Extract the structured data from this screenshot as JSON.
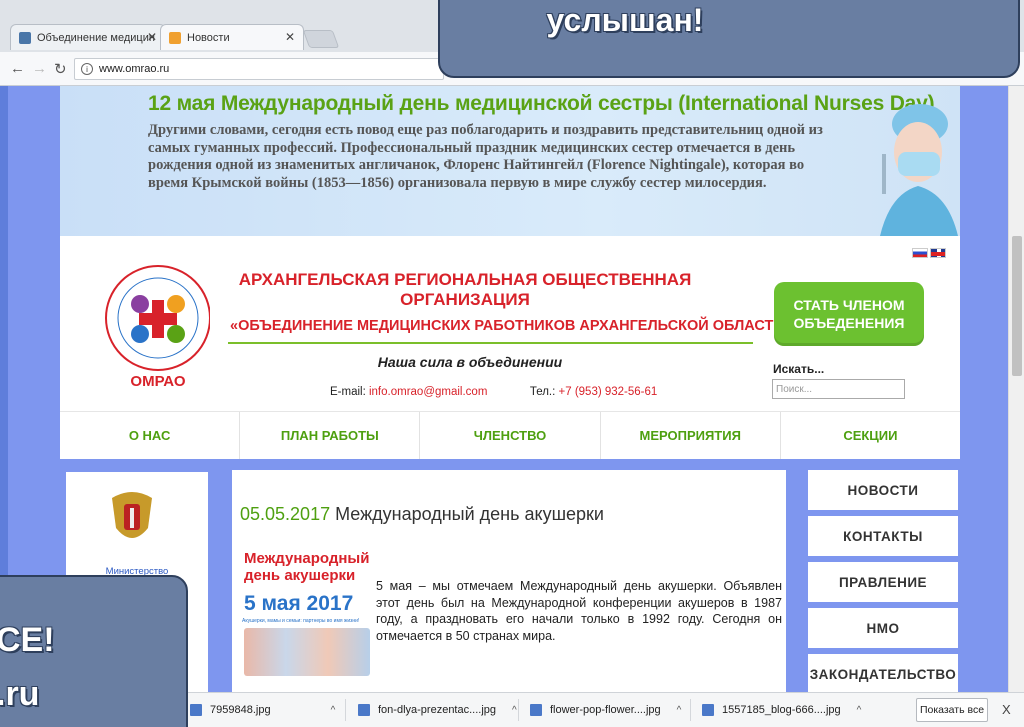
{
  "browser": {
    "tabs": [
      {
        "label": "Объединение медицин",
        "active": false,
        "icon": "vk-icon"
      },
      {
        "label": "Новости",
        "active": true,
        "icon": "site-favicon-icon"
      }
    ],
    "address": "www.omrao.ru"
  },
  "hero": {
    "title": "12 мая Международный день медицинской сестры (International Nurses Day)",
    "text": "Другими словами, сегодня есть повод еще раз поблагодарить и поздравить представительниц одной из самых гуманных профессий. Профессиональный праздник медицинских сестер отмечается в день рождения одной из знаменитых англичанок, Флоренс Найтингейл (Florence Nightingale), которая во время Крымской войны (1853—1856) организовала первую в мире службу сестер милосердия."
  },
  "header": {
    "logo_text": "ОМРАО",
    "logo_ring_text": "ОБЪЕДИНЕНИЕ МЕДИЦИНСКИХ РАБОТНИКОВ АРХАНГЕЛЬСКОЙ ОБЛАСТИ",
    "org_line1": "АРХАНГЕЛЬСКАЯ РЕГИОНАЛЬНАЯ ОБЩЕСТВЕННАЯ ОРГАНИЗАЦИЯ",
    "org_line2": "«ОБЪЕДИНЕНИЕ МЕДИЦИНСКИХ РАБОТНИКОВ АРХАНГЕЛЬСКОЙ ОБЛАСТИ»",
    "motto": "Наша сила в объединении",
    "email_label": "E-mail:",
    "email": "info.omrao@gmail.com",
    "phone_label": "Тел.:",
    "phone": "+7 (953) 932-56-61",
    "join_line1": "СТАТЬ ЧЛЕНОМ",
    "join_line2": "ОБЪЕДЕНЕНИЯ",
    "search_label": "Искать...",
    "search_placeholder": "Поиск..."
  },
  "menu": [
    "О НАС",
    "ПЛАН РАБОТЫ",
    "ЧЛЕНСТВО",
    "МЕРОПРИЯТИЯ",
    "СЕКЦИИ"
  ],
  "left_banner": {
    "text": "Министерство здравоохранения"
  },
  "article": {
    "date": "05.05.2017",
    "title": "Международный день акушерки",
    "image_line1": "Международный",
    "image_line2": "день акушерки",
    "image_date": "5 мая 2017",
    "image_caption": "Акушерки, мамы и семьи: партнеры во имя жизни!",
    "text": "5 мая – мы отмечаем Международный день акушерки. Объявлен этот день был на Международной конференции акушеров в 1987 году, а праздновать его начали только в 1992 году. Сегодня он отмечается в 50 странах мира."
  },
  "side_menu": [
    "НОВОСТИ",
    "КОНТАКТЫ",
    "ПРАВЛЕНИЕ",
    "НМО",
    "ЗАКОНДАТЕЛЬСТВО"
  ],
  "downloads": {
    "items": [
      "7959848.jpg",
      "fon-dlya-prezentac....jpg",
      "flower-pop-flower....jpg",
      "1557185_blog-666....jpg"
    ],
    "show_all": "Показать все",
    "close": "X"
  },
  "overlay": {
    "top_text": "услышан!",
    "bottom_line1": "СЕ!",
    "bottom_line2": ".ru"
  },
  "colors": {
    "page_bg": "#7e96ef",
    "brand_green": "#5aa215",
    "brand_red": "#d8222a",
    "overlay": "#697ea2"
  }
}
